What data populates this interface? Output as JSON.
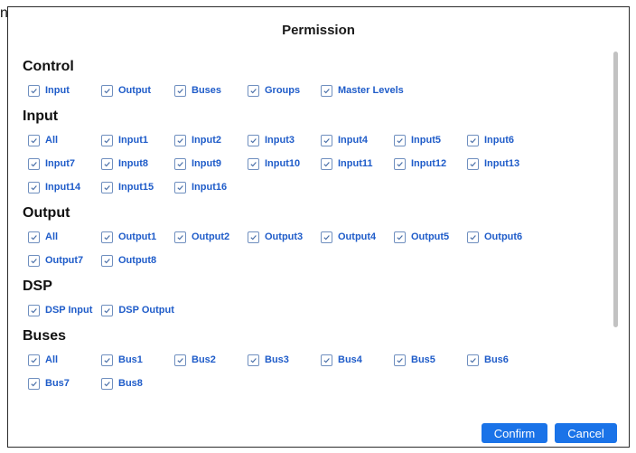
{
  "background_fragment": "ns",
  "dialog": {
    "title": "Permission",
    "accent_color": "#1a73e8",
    "sections": [
      {
        "key": "control",
        "title": "Control",
        "items": [
          "Input",
          "Output",
          "Buses",
          "Groups",
          "Master Levels"
        ]
      },
      {
        "key": "input",
        "title": "Input",
        "items": [
          "All",
          "Input1",
          "Input2",
          "Input3",
          "Input4",
          "Input5",
          "Input6",
          "Input7",
          "Input8",
          "Input9",
          "Input10",
          "Input11",
          "Input12",
          "Input13",
          "Input14",
          "Input15",
          "Input16"
        ]
      },
      {
        "key": "output",
        "title": "Output",
        "items": [
          "All",
          "Output1",
          "Output2",
          "Output3",
          "Output4",
          "Output5",
          "Output6",
          "Output7",
          "Output8"
        ]
      },
      {
        "key": "dsp",
        "title": "DSP",
        "items": [
          "DSP Input",
          "DSP Output"
        ]
      },
      {
        "key": "buses",
        "title": "Buses",
        "items": [
          "All",
          "Bus1",
          "Bus2",
          "Bus3",
          "Bus4",
          "Bus5",
          "Bus6",
          "Bus7",
          "Bus8"
        ]
      }
    ],
    "checked_state": "all-checked",
    "buttons": {
      "confirm": "Confirm",
      "cancel": "Cancel"
    }
  }
}
